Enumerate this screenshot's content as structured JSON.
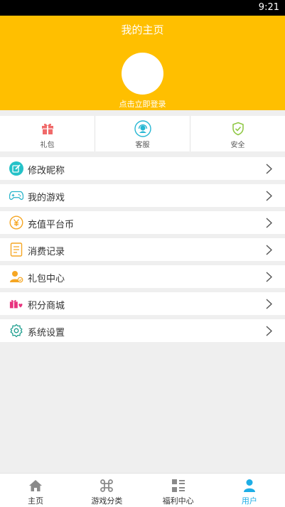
{
  "status": {
    "time": "9:21"
  },
  "header": {
    "title": "我的主页",
    "login_text": "点击立即登录"
  },
  "quick_actions": [
    {
      "label": "礼包",
      "icon": "gift-icon"
    },
    {
      "label": "客服",
      "icon": "customer-service-icon"
    },
    {
      "label": "安全",
      "icon": "shield-icon"
    }
  ],
  "menu": [
    {
      "label": "修改昵称",
      "icon": "edit-icon"
    },
    {
      "label": "我的游戏",
      "icon": "gamepad-icon"
    },
    {
      "label": "充值平台币",
      "icon": "yuan-coin-icon"
    },
    {
      "label": "消费记录",
      "icon": "record-icon"
    },
    {
      "label": "礼包中心",
      "icon": "user-gift-icon"
    },
    {
      "label": "积分商城",
      "icon": "shop-gift-icon"
    },
    {
      "label": "系统设置",
      "icon": "settings-icon"
    }
  ],
  "tabbar": [
    {
      "label": "主页",
      "icon": "home-icon"
    },
    {
      "label": "游戏分类",
      "icon": "command-icon"
    },
    {
      "label": "福利中心",
      "icon": "grid-list-icon"
    },
    {
      "label": "用户",
      "icon": "user-icon",
      "active": true
    }
  ],
  "colors": {
    "header_bg": "#ffbf00",
    "active_tab": "#1eaee6",
    "page_bg": "#efefef"
  }
}
